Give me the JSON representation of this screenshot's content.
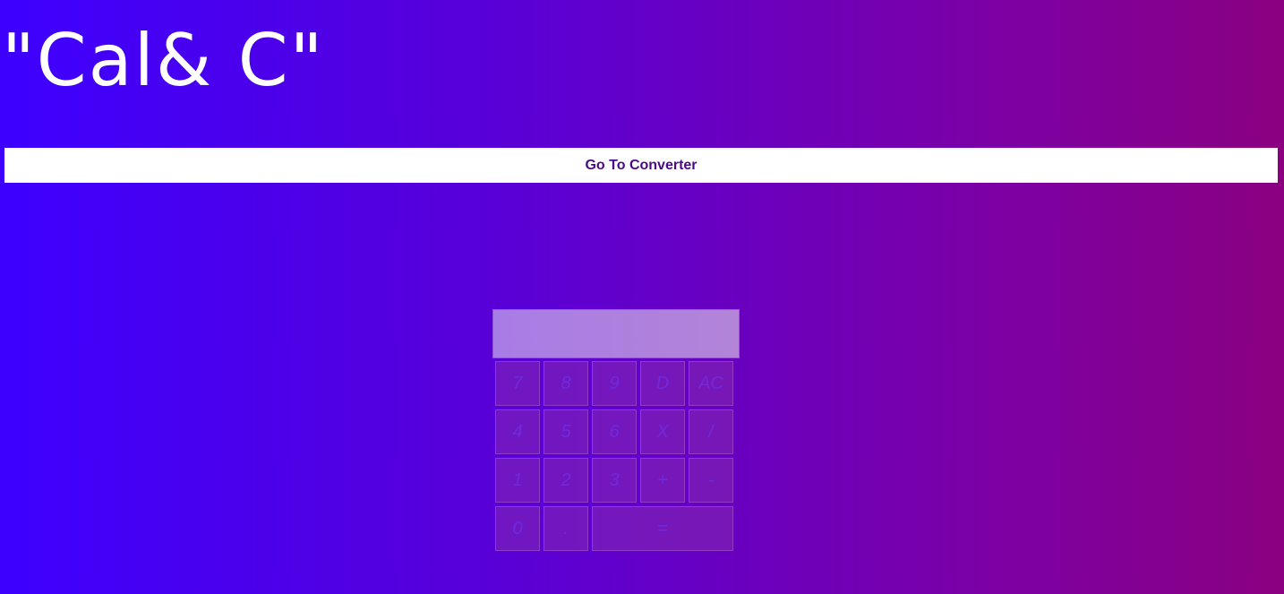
{
  "header": {
    "title": "\"Cal& C\""
  },
  "nav": {
    "converter_button_label": "Go To Converter"
  },
  "calculator": {
    "display_value": "",
    "keys": {
      "row1": [
        "7",
        "8",
        "9",
        "D",
        "AC"
      ],
      "row2": [
        "4",
        "5",
        "6",
        "X",
        "/"
      ],
      "row3": [
        "1",
        "2",
        "3",
        "+",
        "-"
      ],
      "row4": [
        "0",
        ".",
        "="
      ]
    }
  },
  "colors": {
    "gradient_start": "#3d00ff",
    "gradient_end": "#8a0080",
    "button_text": "#4a0a8a"
  }
}
